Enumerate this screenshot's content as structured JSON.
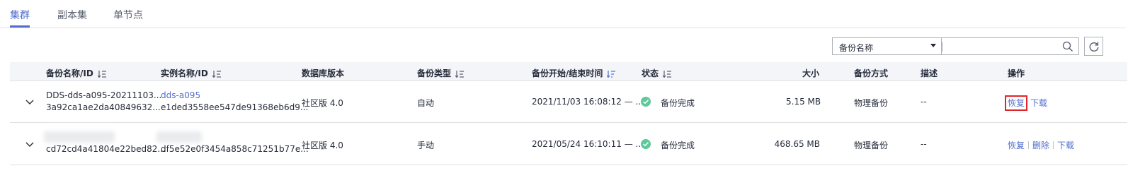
{
  "tabs": [
    {
      "label": "集群",
      "active": true
    },
    {
      "label": "副本集",
      "active": false
    },
    {
      "label": "单节点",
      "active": false
    }
  ],
  "search": {
    "filter_label": "备份名称",
    "placeholder": ""
  },
  "table": {
    "columns": [
      {
        "label": "备份名称/ID",
        "sortable": true
      },
      {
        "label": "实例名称/ID",
        "sortable": true
      },
      {
        "label": "数据库版本",
        "sortable": false
      },
      {
        "label": "备份类型",
        "sortable": true
      },
      {
        "label": "备份开始/结束时间",
        "sortable": true,
        "active_sort": true
      },
      {
        "label": "状态",
        "sortable": true
      },
      {
        "label": "大小",
        "sortable": false
      },
      {
        "label": "备份方式",
        "sortable": false
      },
      {
        "label": "描述",
        "sortable": false
      },
      {
        "label": "操作",
        "sortable": false
      }
    ],
    "rows": [
      {
        "backup_name": "DDS-dds-a095-20211103...",
        "backup_id": "3a92ca1ae2da40849632...",
        "instance_name": "dds-a095",
        "instance_id": "e1ded3558ee547de91368eb6d9...",
        "db_version": "社区版 4.0",
        "backup_type": "自动",
        "time": "2021/11/03 16:08:12 — ...",
        "status": "备份完成",
        "size": "5.15 MB",
        "method": "物理备份",
        "description": "--",
        "ops": [
          "恢复",
          "下载"
        ]
      },
      {
        "backup_name": "",
        "backup_id": "cd72cd4a41804e22bed82...",
        "instance_name": "",
        "instance_id": "df5e52e0f3454a858c71251b77e...",
        "db_version": "社区版 4.0",
        "backup_type": "手动",
        "time": "2021/05/24 16:10:11 — ...",
        "status": "备份完成",
        "size": "468.65 MB",
        "method": "物理备份",
        "description": "--",
        "ops": [
          "恢复",
          "删除",
          "下载"
        ]
      }
    ]
  },
  "colors": {
    "accent": "#526ecc",
    "success": "#5ec99a",
    "highlight": "#e0262a"
  }
}
